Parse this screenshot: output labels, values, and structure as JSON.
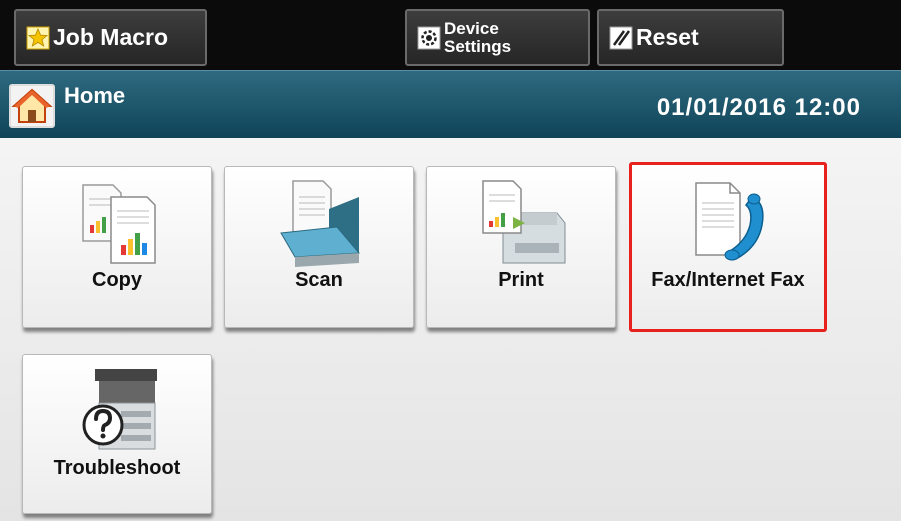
{
  "topbar": {
    "job_macro_label": "Job Macro",
    "device_settings_line1": "Device",
    "device_settings_line2": "Settings",
    "reset_label": "Reset"
  },
  "header": {
    "title": "Home",
    "datetime": "01/01/2016 12:00"
  },
  "tiles": [
    {
      "label": "Copy",
      "icon": "copy-icon"
    },
    {
      "label": "Scan",
      "icon": "scanner-icon"
    },
    {
      "label": "Print",
      "icon": "printer-icon"
    },
    {
      "label": "Fax/Internet Fax",
      "icon": "fax-phone-icon",
      "selected": true
    },
    {
      "label": "Troubleshoot",
      "icon": "troubleshoot-icon"
    }
  ],
  "colors": {
    "topbar_bg": "#0b0b0b",
    "header_bg": "#1a5468",
    "selected_border": "#e8201e",
    "star_yellow": "#f5c400"
  }
}
